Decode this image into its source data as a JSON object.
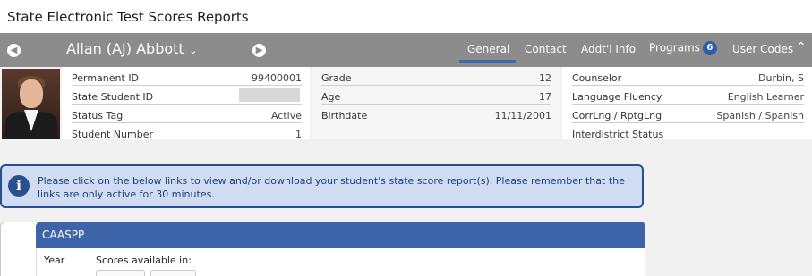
{
  "app": {
    "title": "State Electronic Test Scores Reports"
  },
  "navbar": {
    "student_name": "Allan (AJ) Abbott",
    "tabs": [
      {
        "label": "General",
        "active": true
      },
      {
        "label": "Contact",
        "active": false
      },
      {
        "label": "Addt'l Info",
        "active": false
      },
      {
        "label": "Programs",
        "active": false,
        "badge": "6"
      },
      {
        "label": "User Codes",
        "active": false
      }
    ],
    "icons": {
      "prev": "arrow-left-icon",
      "next": "arrow-right-icon",
      "dropdown": "chevron-down-icon",
      "collapse": "chevron-up-icon"
    }
  },
  "student_info": {
    "col1": [
      {
        "label": "Permanent ID",
        "value": "99400001"
      },
      {
        "label": "State Student ID",
        "value": ""
      },
      {
        "label": "Status Tag",
        "value": "Active"
      },
      {
        "label": "Student Number",
        "value": "1"
      }
    ],
    "col2": [
      {
        "label": "Grade",
        "value": "12"
      },
      {
        "label": "Age",
        "value": "17"
      },
      {
        "label": "Birthdate",
        "value": "11/11/2001"
      }
    ],
    "col3": [
      {
        "label": "Counselor",
        "value": "Durbin, S"
      },
      {
        "label": "Language Fluency",
        "value": "English Learner"
      },
      {
        "label": "CorrLng / RptgLng",
        "value": "Spanish / Spanish"
      },
      {
        "label": "Interdistrict Status",
        "value": ""
      }
    ]
  },
  "alert": {
    "message": "Please click on the below links to view and/or download your student's state score report(s). Please remember that the links are only active for 30 minutes."
  },
  "panel": {
    "title": "CAASPP",
    "columns": [
      "Year",
      "Scores available in:"
    ]
  },
  "colors": {
    "navbar": "#8c8c8c",
    "accent": "#3d64a8",
    "alert_bg": "#cfdcf2",
    "alert_border": "#2a4f8f",
    "badge": "#2f5ea8"
  }
}
